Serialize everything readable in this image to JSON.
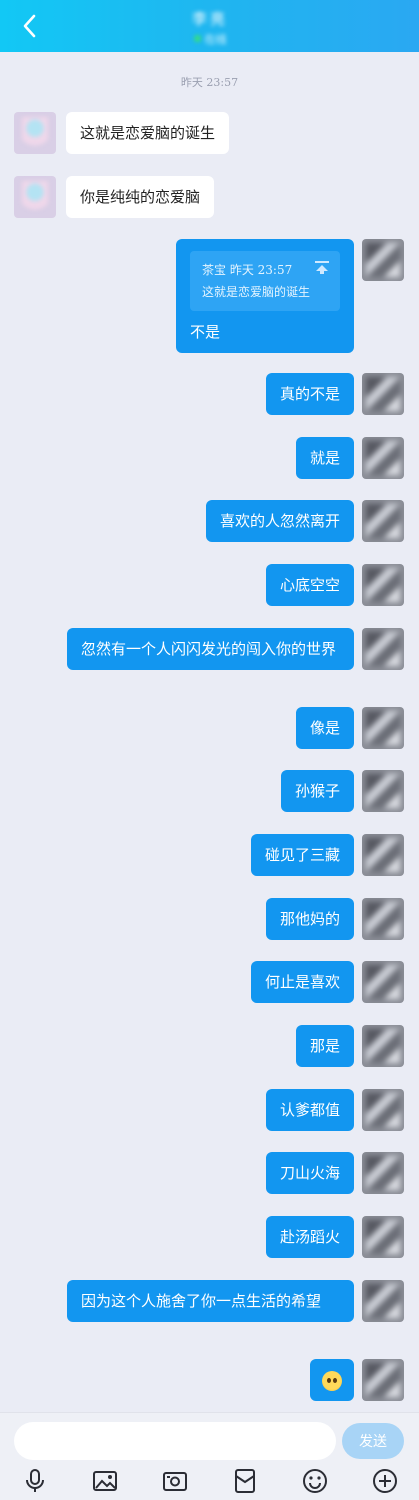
{
  "header": {
    "contact_name": "李亮",
    "contact_status": "在线"
  },
  "timestamp": "昨天 23:57",
  "messages": [
    {
      "side": "in",
      "text": "这就是恋爱脑的诞生"
    },
    {
      "side": "in",
      "text": "你是纯纯的恋爱脑"
    },
    {
      "side": "out",
      "quote_header": "茶宝 昨天 23:57",
      "quote_text": "这就是恋爱脑的诞生",
      "text": "不是"
    },
    {
      "side": "out",
      "text": "真的不是"
    },
    {
      "side": "out",
      "text": "就是"
    },
    {
      "side": "out",
      "text": "喜欢的人忽然离开"
    },
    {
      "side": "out",
      "text": "心底空空"
    },
    {
      "side": "out",
      "text": "忽然有一个人闪闪发光的闯入你的世界"
    },
    {
      "side": "out",
      "text": "像是"
    },
    {
      "side": "out",
      "text": "孙猴子"
    },
    {
      "side": "out",
      "text": "碰见了三藏"
    },
    {
      "side": "out",
      "text": "那他妈的"
    },
    {
      "side": "out",
      "text": "何止是喜欢"
    },
    {
      "side": "out",
      "text": "那是"
    },
    {
      "side": "out",
      "text": "认爹都值"
    },
    {
      "side": "out",
      "text": "刀山火海"
    },
    {
      "side": "out",
      "text": "赴汤蹈火"
    },
    {
      "side": "out",
      "text": "因为这个人施舍了你一点生活的希望"
    },
    {
      "side": "out",
      "emoji": "pleading-face"
    }
  ],
  "input": {
    "value": "",
    "send_label": "发送"
  },
  "toolbar": [
    "mic-icon",
    "image-icon",
    "camera-icon",
    "red-packet-icon",
    "emoji-icon",
    "plus-icon"
  ],
  "colors": {
    "header": "#1fb6f0",
    "bubble_out": "#1296f0",
    "bubble_in": "#ffffff",
    "background": "#eaecf5",
    "send_button": "#a8d4f6"
  }
}
